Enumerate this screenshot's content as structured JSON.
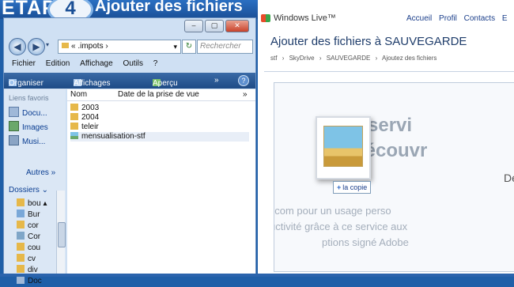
{
  "banner": {
    "step_text": "ETAPE",
    "step_number": "4",
    "title_rest": "Ajouter des fichiers"
  },
  "explorer": {
    "window_controls": [
      "‒",
      "▢",
      "✕"
    ],
    "address": {
      "path": "« .impots ›",
      "search_placeholder": "Rechercher"
    },
    "menu": [
      "Fichier",
      "Edition",
      "Affichage",
      "Outils",
      "?"
    ],
    "toolbar": {
      "organize": "Organiser ▾",
      "views": "Affichages ▾",
      "preview": "Aperçu ▾",
      "more": "»",
      "help": "?"
    },
    "nav": {
      "favorites_label": "Liens favoris",
      "favorites": [
        {
          "label": "Docu...",
          "icon": "documents-icon"
        },
        {
          "label": "Images",
          "icon": "images-icon"
        },
        {
          "label": "Musi...",
          "icon": "music-icon"
        }
      ],
      "more_label": "Autres »",
      "folders_label": "Dossiers ⌄",
      "tree": [
        "bou ▴",
        "Bur",
        "cor",
        "Cor",
        "cou",
        "cv",
        "div",
        "Doc"
      ]
    },
    "columns": {
      "name": "Nom",
      "date": "Date de la prise de vue",
      "more": "»"
    },
    "files": [
      {
        "name": "2003",
        "type": "folder"
      },
      {
        "name": "2004",
        "type": "folder"
      },
      {
        "name": "teleir",
        "type": "folder"
      },
      {
        "name": "mensualisation-stf",
        "type": "file"
      }
    ]
  },
  "live": {
    "logo_text": "Windows Live™",
    "links": [
      "Accueil",
      "Profil",
      "Contacts",
      "E"
    ],
    "title": "Ajouter des fichiers à SAUVEGARDE",
    "breadcrumb": [
      "stf",
      "›",
      "SkyDrive",
      "›",
      "SAUVEGARDE",
      "›",
      "Ajoutez des fichiers"
    ],
    "ghost_lines": [
      "eux servi",
      "découvr",
      "De"
    ],
    "ghost_small": [
      "ive.com pour un usage perso",
      "uctivité grâce à ce service aux",
      "ptions signé Adobe"
    ],
    "copy_tag": "la copie",
    "copy_plus": "+"
  }
}
